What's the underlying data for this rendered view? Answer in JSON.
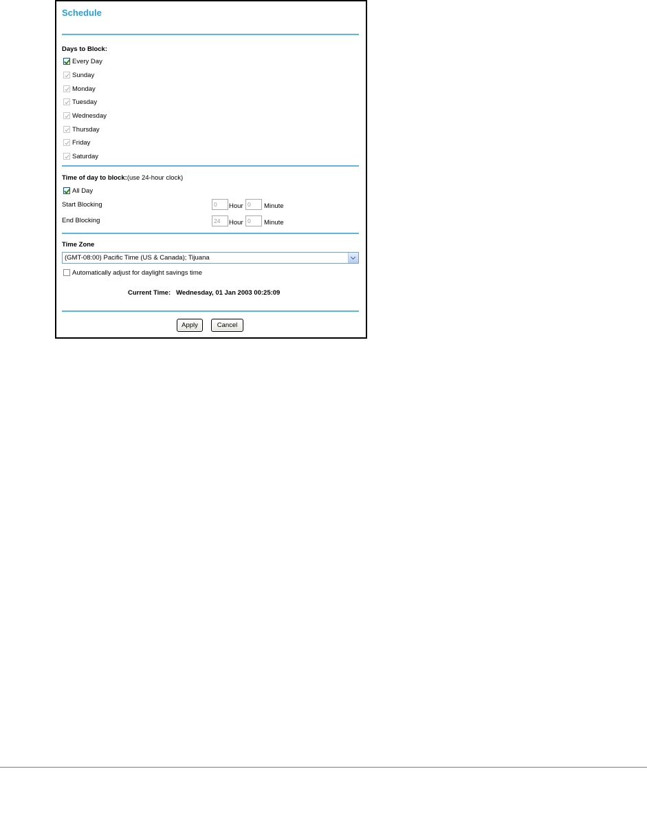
{
  "title": "Schedule",
  "days": {
    "heading": "Days to Block:",
    "every_day": "Every Day",
    "items": [
      {
        "label": "Sunday"
      },
      {
        "label": "Monday"
      },
      {
        "label": "Tuesday"
      },
      {
        "label": "Wednesday"
      },
      {
        "label": "Thursday"
      },
      {
        "label": "Friday"
      },
      {
        "label": "Saturday"
      }
    ]
  },
  "time": {
    "heading": "Time of day to block:",
    "hint": "(use 24-hour clock)",
    "all_day": "All Day",
    "start_label": "Start Blocking",
    "end_label": "End Blocking",
    "start_hour": "0",
    "start_minute": "0",
    "end_hour": "24",
    "end_minute": "0",
    "hour_unit": "Hour",
    "minute_unit": "Minute"
  },
  "timezone": {
    "heading": "Time Zone",
    "selected": "(GMT-08:00) Pacific Time (US & Canada); Tijuana",
    "dst_label": "Automatically adjust for daylight savings time",
    "current_time_label": "Current Time:",
    "current_time_value": "Wednesday, 01 Jan 2003 00:25:09"
  },
  "buttons": {
    "apply": "Apply",
    "cancel": "Cancel"
  },
  "colors": {
    "title": "#2a9fd6",
    "rule": "#5bb6e0"
  }
}
